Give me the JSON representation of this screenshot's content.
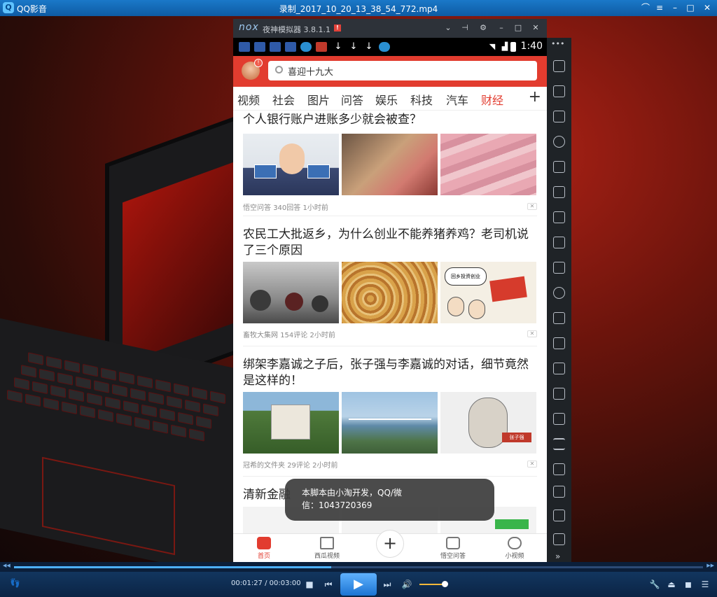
{
  "player": {
    "app_name": "QQ影音",
    "logo_glyph": "Q",
    "file_name": "录制_2017_10_20_13_38_54_772.mp4",
    "window_buttons": {
      "skin": "⌒",
      "menu": "≡",
      "minimize": "–",
      "maximize": "□",
      "close": "✕"
    },
    "progress_fraction": 0.46,
    "controls": {
      "time": "00:01:27 / 00:03:00",
      "stop": "■",
      "prev": "⏮",
      "play": "▶",
      "next": "⏭",
      "volume": "🔊",
      "volume_fraction": 0.9
    },
    "tray": {
      "settings": "🔧",
      "eject": "⏏",
      "color": "◼",
      "playlist": "☰"
    },
    "seek_left": "◀◀",
    "seek_right": "▶▶",
    "footprint": "👣"
  },
  "emulator": {
    "logo": "nox",
    "title": "夜神模拟器 3.8.1.1",
    "flag": "!",
    "buttons": {
      "dropdown": "⌄",
      "pin": "⊣",
      "settings": "⚙",
      "minimize": "–",
      "maximize": "□",
      "close": "✕"
    },
    "toolbar_more": "•••",
    "toolbar_collapse": "»"
  },
  "phone": {
    "status": {
      "clock": "1:40"
    },
    "avatar_badge": "!",
    "search_placeholder": "喜迎十九大",
    "tabs": [
      "视频",
      "社会",
      "图片",
      "问答",
      "娱乐",
      "科技",
      "汽车",
      "财经"
    ],
    "active_tab": "财经",
    "add_channel": "+",
    "articles": [
      {
        "title": "个人银行账户进账多少就会被查？",
        "source": "悟空问答",
        "comments": "340回答",
        "time": "1小时前"
      },
      {
        "title": "农民工大批返乡，为什么创业不能养猪养鸡？老司机说了三个原因",
        "source": "畜牧大集网",
        "comments": "154评论",
        "time": "2小时前"
      },
      {
        "title": "绑架李嘉诚之子后，张子强与李嘉诚的对话，细节竟然是这样的！",
        "source": "冠希的文件夹",
        "comments": "29评论",
        "time": "2小时前"
      },
      {
        "title": "清新金融"
      }
    ],
    "image_texts": {
      "panel": "回乡投资创业",
      "sign": "张子强"
    },
    "dislike_glyph": "✕",
    "nav": {
      "home": "首页",
      "xigua": "西瓜视频",
      "plus": "+",
      "wukong": "悟空问答",
      "small_video": "小视频"
    },
    "toast": [
      "本脚本由小淘开发，QQ/微",
      "信：1043720369"
    ]
  },
  "colors": {
    "brand_red": "#e23c2f",
    "player_blue": "#1a78c8"
  }
}
